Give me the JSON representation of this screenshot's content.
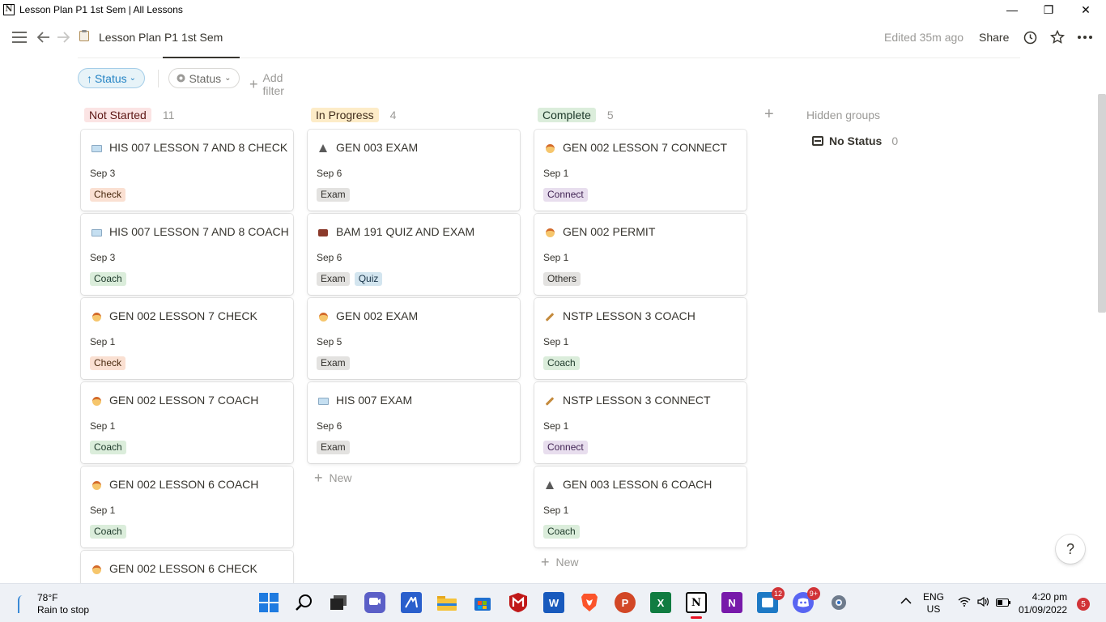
{
  "window": {
    "title": "Lesson Plan P1 1st Sem | All Lessons",
    "minimize": "—",
    "restore": "❐",
    "close": "✕"
  },
  "topbar": {
    "page_icon": "clipboard-icon",
    "page_title": "Lesson Plan P1 1st Sem",
    "edited": "Edited 35m ago",
    "share": "Share"
  },
  "filters": {
    "sort_label": "Status",
    "filter_label": "Status",
    "add_filter": "Add filter"
  },
  "board": {
    "columns": [
      {
        "name": "Not Started",
        "count": "11",
        "color": "#fbe4e4",
        "cards": [
          {
            "icon": "book-icon",
            "title": "HIS 007 LESSON 7 AND 8 CHECK",
            "date": "Sep 3",
            "tags": [
              "Check"
            ]
          },
          {
            "icon": "book-icon",
            "title": "HIS 007 LESSON 7 AND 8 COACH",
            "date": "Sep 3",
            "tags": [
              "Coach"
            ]
          },
          {
            "icon": "face-icon",
            "title": "GEN 002 LESSON 7 CHECK",
            "date": "Sep 1",
            "tags": [
              "Check"
            ]
          },
          {
            "icon": "face-icon",
            "title": "GEN 002 LESSON 7 COACH",
            "date": "Sep 1",
            "tags": [
              "Coach"
            ]
          },
          {
            "icon": "face-icon",
            "title": "GEN 002 LESSON 6 COACH",
            "date": "Sep 1",
            "tags": [
              "Coach"
            ]
          },
          {
            "icon": "face-icon",
            "title": "GEN 002 LESSON 6 CHECK",
            "date": "",
            "tags": []
          }
        ]
      },
      {
        "name": "In Progress",
        "count": "4",
        "color": "#fdecc8",
        "cards": [
          {
            "icon": "flask-icon",
            "title": "GEN 003 EXAM",
            "date": "Sep 6",
            "tags": [
              "Exam"
            ]
          },
          {
            "icon": "briefcase-icon",
            "title": "BAM 191 QUIZ AND EXAM",
            "date": "Sep 6",
            "tags": [
              "Exam",
              "Quiz"
            ]
          },
          {
            "icon": "face-icon",
            "title": "GEN 002 EXAM",
            "date": "Sep 5",
            "tags": [
              "Exam"
            ]
          },
          {
            "icon": "book-icon",
            "title": "HIS 007 EXAM",
            "date": "Sep 6",
            "tags": [
              "Exam"
            ]
          }
        ],
        "new_label": "New"
      },
      {
        "name": "Complete",
        "count": "5",
        "color": "#dbeddb",
        "cards": [
          {
            "icon": "face-icon",
            "title": "GEN 002 LESSON 7 CONNECT",
            "date": "Sep 1",
            "tags": [
              "Connect"
            ]
          },
          {
            "icon": "face-icon",
            "title": "GEN 002 PERMIT",
            "date": "Sep 1",
            "tags": [
              "Others"
            ]
          },
          {
            "icon": "broom-icon",
            "title": "NSTP LESSON 3 COACH",
            "date": "Sep 1",
            "tags": [
              "Coach"
            ]
          },
          {
            "icon": "broom-icon",
            "title": "NSTP LESSON 3 CONNECT",
            "date": "Sep 1",
            "tags": [
              "Connect"
            ]
          },
          {
            "icon": "flask-icon",
            "title": "GEN 003 LESSON 6 COACH",
            "date": "Sep 1",
            "tags": [
              "Coach"
            ]
          }
        ],
        "new_label": "New"
      }
    ],
    "hidden_groups_label": "Hidden groups",
    "no_status_label": "No Status",
    "no_status_count": "0"
  },
  "help": "?",
  "taskbar": {
    "temperature": "78°F",
    "weather_text": "Rain to stop",
    "teams_badge": "12",
    "discord_badge": "9+",
    "language": "ENG",
    "region": "US",
    "time": "4:20 pm",
    "date": "01/09/2022",
    "notification_count": "5"
  }
}
